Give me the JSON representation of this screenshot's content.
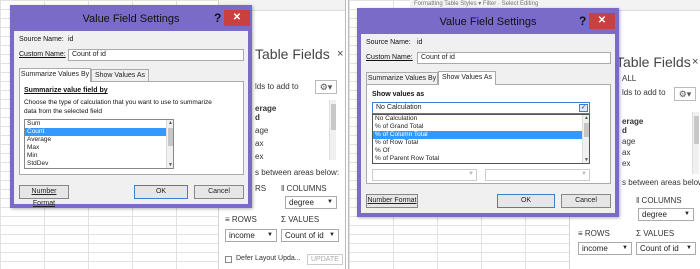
{
  "left": {
    "ribbon": "",
    "field_panel": {
      "title": "Table Fields",
      "close": "×",
      "subtitle": "lds to add to",
      "list_fields": [
        "erage",
        "d",
        "age",
        "ax",
        "ex"
      ],
      "drag_text": "s between areas below:",
      "areas": {
        "filters_short": "RS",
        "columns_label": "COLUMNS",
        "columns_value": "degree",
        "rows_label": "ROWS",
        "rows_value": "income",
        "values_label": "VALUES",
        "values_value": "Count of id"
      },
      "defer_label": "Defer Layout Upda...",
      "update_label": "UPDATE"
    },
    "dialog": {
      "title": "Value Field Settings",
      "help": "?",
      "close": "✕",
      "source_label": "Source Name:",
      "source_value": "id",
      "custom_label": "Custom Name:",
      "custom_value": "Count of id",
      "tabs": [
        "Summarize Values By",
        "Show Values As"
      ],
      "section_title": "Summarize value field by",
      "description": "Choose the type of calculation that you want to use to summarize data from the selected field",
      "functions": [
        "Sum",
        "Count",
        "Average",
        "Max",
        "Min",
        "StdDev"
      ],
      "selected_function": "Count",
      "number_format": "Number Format",
      "ok": "OK",
      "cancel": "Cancel"
    }
  },
  "right": {
    "ribbon": "Formatting    Table    Styles  ▾          Filter · Select      Editing",
    "field_panel": {
      "title": "Table Fields",
      "close": "×",
      "all_tab": "ALL",
      "subtitle": "lds to add to",
      "list_fields": [
        "erage",
        "d",
        "age",
        "ax",
        "ex"
      ],
      "drag_text": "s between areas below:",
      "areas": {
        "columns_label": "COLUMNS",
        "columns_value": "degree",
        "rows_label": "ROWS",
        "rows_value": "income",
        "values_label": "VALUES",
        "values_value": "Count of id"
      }
    },
    "dialog": {
      "title": "Value Field Settings",
      "help": "?",
      "close": "✕",
      "source_label": "Source Name:",
      "source_value": "id",
      "custom_label": "Custom Name:",
      "custom_value": "Count of id",
      "tabs": [
        "Summarize Values By",
        "Show Values As"
      ],
      "section_title": "Show values as",
      "combo_value": "No Calculation",
      "options": [
        "No Calculation",
        "% of Grand Total",
        "% of Column Total",
        "% of Row Total",
        "% Of",
        "% of Parent Row Total"
      ],
      "selected_option": "% of Column Total",
      "number_format": "Number Format",
      "ok": "OK",
      "cancel": "Cancel"
    }
  },
  "colors": {
    "dialog_frame": "#7b6bc9",
    "close_button": "#c94040",
    "selection": "#3399ff",
    "focus_border": "#3c7fd6"
  },
  "icons": [
    "help-icon",
    "close-icon",
    "gear-icon",
    "chevron-down-icon",
    "columns-icon",
    "sigma-icon",
    "rows-icon"
  ]
}
